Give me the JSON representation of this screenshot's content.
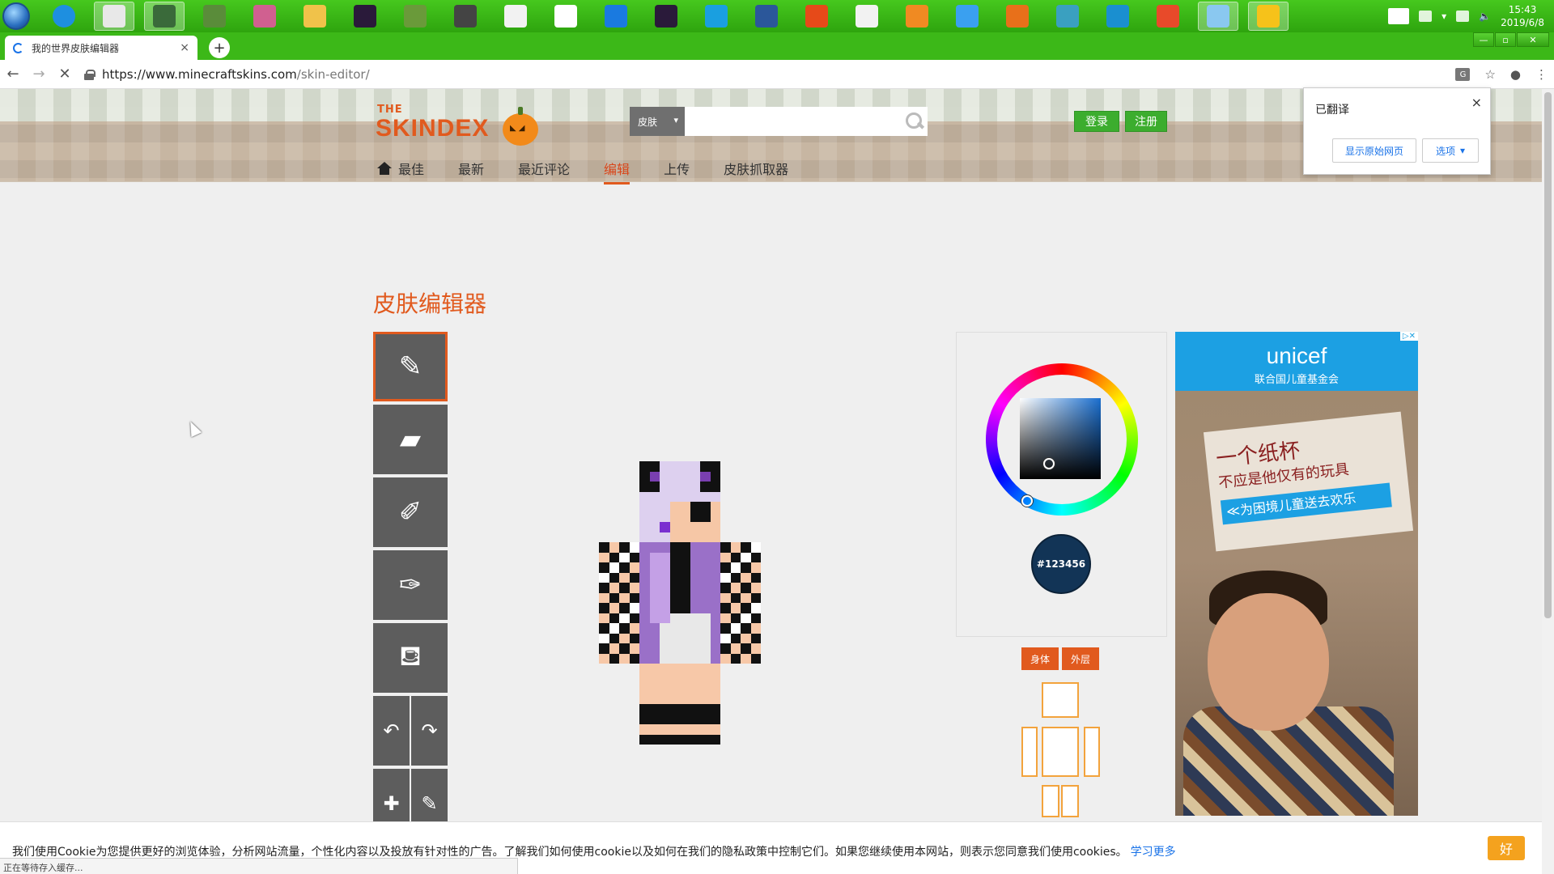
{
  "taskbar": {
    "icons": [
      "ie-icon",
      "chrome-icon",
      "app-icon",
      "tree-icon",
      "anime-icon",
      "folder-icon",
      "enderman-icon",
      "grass-block-icon",
      "sword-icon",
      "notepad-icon",
      "itunes-icon",
      "k-icon",
      "enderman2-icon",
      "qq-icon",
      "word-icon",
      "wps-icon",
      "slides-icon",
      "video-icon",
      "baidu-icon",
      "calendar-icon",
      "puzzle-icon",
      "screen-icon",
      "app2-icon",
      "monitor-icon",
      "yellow-app-icon"
    ],
    "time": "15:43",
    "date": "2019/6/8"
  },
  "browser": {
    "tab_title": "我的世界皮肤编辑器",
    "tab_close": "×",
    "new_tab": "+",
    "url_host": "https://www.minecraftskins.com",
    "url_path": "/skin-editor/",
    "window_controls": [
      "—",
      "▫",
      "✕"
    ]
  },
  "site": {
    "logo_the": "THE",
    "logo_main": "SKINDEX",
    "search_category": "皮肤",
    "search_placeholder": "",
    "login": "登录",
    "register": "注册",
    "nav": [
      "最佳",
      "最新",
      "最近评论",
      "编辑",
      "上传",
      "皮肤抓取器"
    ],
    "active_nav": "编辑"
  },
  "editor": {
    "title": "皮肤编辑器",
    "tools": [
      "pencil-icon",
      "eraser-icon",
      "brush-icon",
      "eyedropper-icon",
      "bucket-icon",
      "undo-icon",
      "redo-icon",
      "darken-icon",
      "lighten-icon"
    ],
    "color_hex": "#123456",
    "layer_body": "身体",
    "layer_outer": "外层"
  },
  "ad": {
    "brand": "unicef",
    "sub": "联合国儿童基金会",
    "line1": "一个纸杯",
    "line2": "不应是他仅有的玩具",
    "line3": "≪为困境儿童送去欢乐"
  },
  "translate_popup": {
    "title": "已翻译",
    "show_original": "显示原始网页",
    "options": "选项",
    "close": "×"
  },
  "cookie": {
    "text": "我们使用Cookie为您提供更好的浏览体验，分析网站流量，个性化内容以及投放有针对性的广告。了解我们如何使用cookie以及如何在我们的隐私政策中控制它们。如果您继续使用本网站，则表示您同意我们使用cookies。",
    "link": "学习更多",
    "ok": "好"
  },
  "status": "正在等待存入缓存..."
}
